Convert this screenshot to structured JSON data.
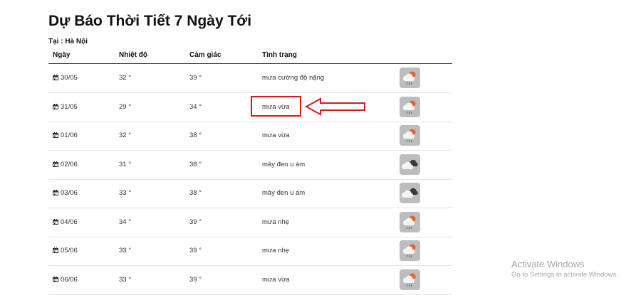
{
  "page": {
    "title": "Dự Báo Thời Tiết 7 Ngày Tới",
    "location": "Tại : Hà Nội"
  },
  "table": {
    "headers": [
      "Ngày",
      "Nhiệt độ",
      "Cảm giác",
      "Tình trạng"
    ],
    "rows": [
      {
        "date": "30/05",
        "temp": "32 °",
        "feels": "39 °",
        "status": "mưa cường độ nặng",
        "icon": "rain-cloud-icon"
      },
      {
        "date": "31/05",
        "temp": "29 °",
        "feels": "34 °",
        "status": "mưa vừa",
        "icon": "rain-cloud-icon"
      },
      {
        "date": "01/06",
        "temp": "32 °",
        "feels": "38 °",
        "status": "mưa vừa",
        "icon": "rain-cloud-icon"
      },
      {
        "date": "02/06",
        "temp": "31 °",
        "feels": "38 °",
        "status": "mây đen u ám",
        "icon": "overcast-clouds-icon"
      },
      {
        "date": "03/06",
        "temp": "33 °",
        "feels": "38 °",
        "status": "mây đen u ám",
        "icon": "overcast-clouds-icon"
      },
      {
        "date": "04/06",
        "temp": "34 °",
        "feels": "39 °",
        "status": "mưa nhẹ",
        "icon": "rain-cloud-icon"
      },
      {
        "date": "05/06",
        "temp": "33 °",
        "feels": "39 °",
        "status": "mưa nhẹ",
        "icon": "rain-cloud-icon"
      },
      {
        "date": "06/06",
        "temp": "33 °",
        "feels": "39 °",
        "status": "mưa vừa",
        "icon": "rain-cloud-icon"
      }
    ]
  },
  "annotation": {
    "highlighted_text": "mưa vừa",
    "color": "#d21d1d"
  },
  "watermark": {
    "line1": "Activate Windows",
    "line2": "Go to Settings to activate Windows."
  },
  "colors": {
    "icon_bg": "#bdbdbd",
    "sun": "#e8622c",
    "dark_cloud": "#3a3a3a"
  }
}
